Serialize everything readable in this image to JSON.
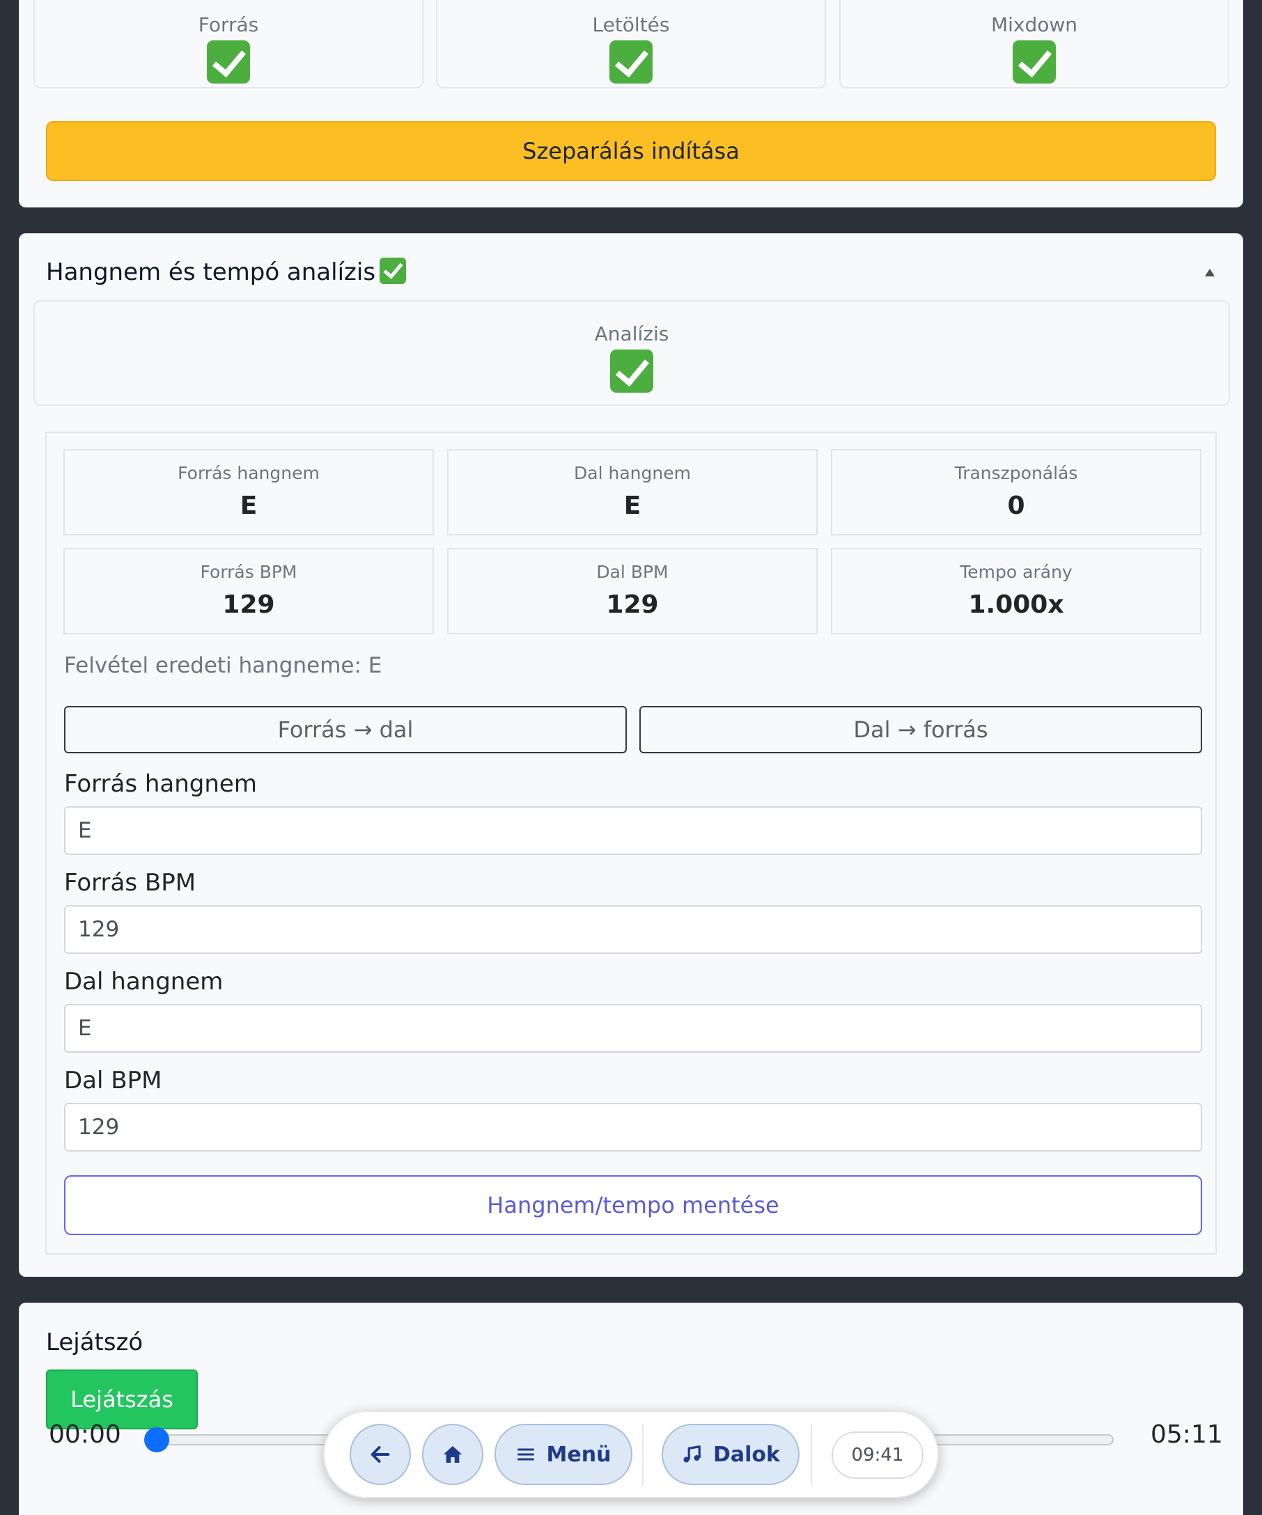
{
  "steps": [
    {
      "label": "Forrás"
    },
    {
      "label": "Letöltés"
    },
    {
      "label": "Mixdown"
    }
  ],
  "separation": {
    "start_label": "Szeparálás indítása"
  },
  "analysis": {
    "title": "Hangnem és tempó analízis",
    "step_label": "Analízis",
    "stats": [
      {
        "label": "Forrás hangnem",
        "value": "E"
      },
      {
        "label": "Dal hangnem",
        "value": "E"
      },
      {
        "label": "Transzponálás",
        "value": "0"
      },
      {
        "label": "Forrás BPM",
        "value": "129"
      },
      {
        "label": "Dal BPM",
        "value": "129"
      },
      {
        "label": "Tempo arány",
        "value": "1.000x"
      }
    ],
    "note": "Felvétel eredeti hangneme: E",
    "copy_buttons": {
      "source_to_song": "Forrás → dal",
      "song_to_source": "Dal → forrás"
    },
    "fields": {
      "source_key": {
        "label": "Forrás hangnem",
        "value": "E"
      },
      "source_bpm": {
        "label": "Forrás BPM",
        "value": "129"
      },
      "song_key": {
        "label": "Dal hangnem",
        "value": "E"
      },
      "song_bpm": {
        "label": "Dal BPM",
        "value": "129"
      }
    },
    "save_label": "Hangnem/tempo mentése"
  },
  "player": {
    "title": "Lejátszó",
    "play_label": "Lejátszás",
    "current_time": "00:00",
    "total_time": "05:11",
    "progress": 0
  },
  "nav": {
    "menu_label": "Menü",
    "songs_label": "Dalok",
    "clock": "09:41"
  },
  "colors": {
    "background": "#2b303b",
    "warning": "#fbbf24",
    "success": "#22c55e",
    "primary_outline": "#6366f1",
    "check": "#4cae3f",
    "slider_thumb": "#0d6efd"
  }
}
